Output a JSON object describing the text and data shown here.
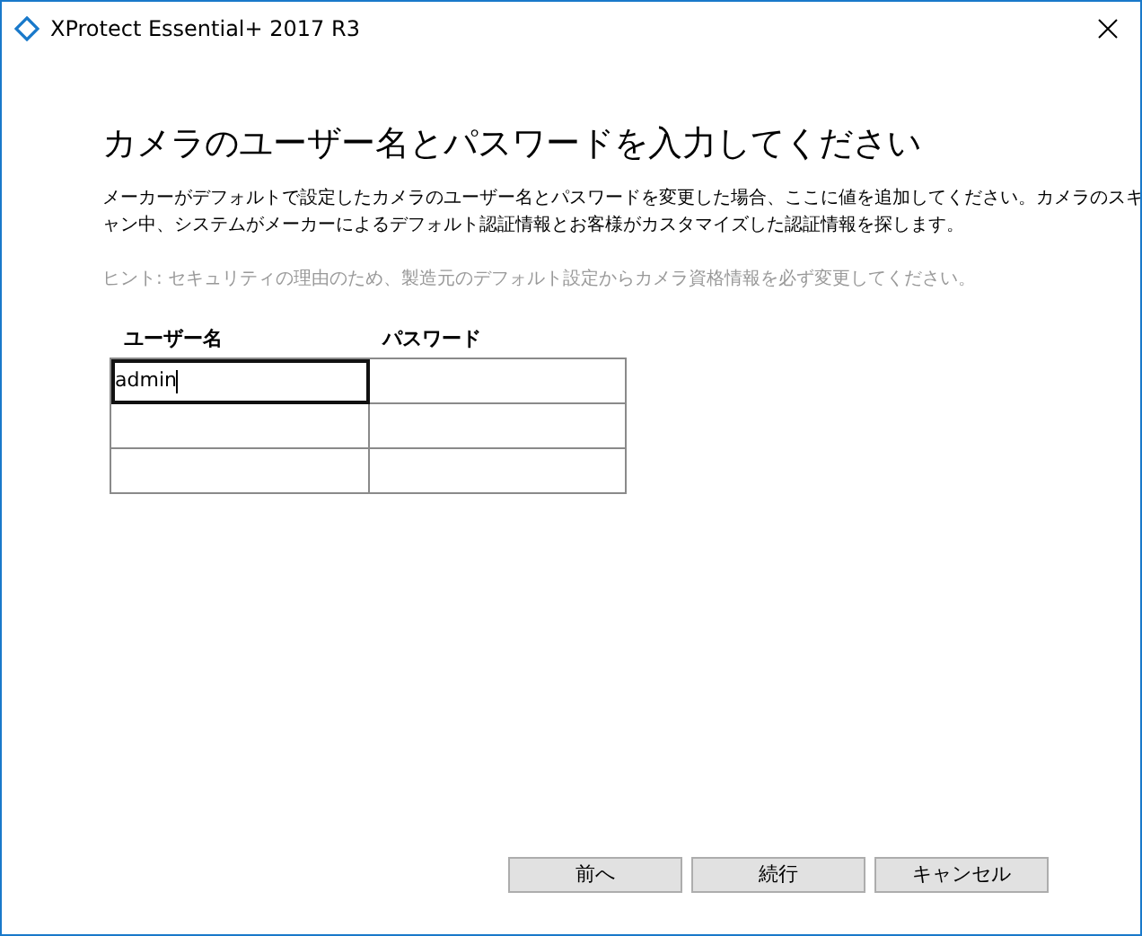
{
  "window": {
    "title": "XProtect Essential+ 2017 R3"
  },
  "heading": "カメラのユーザー名とパスワードを入力してください",
  "description": "メーカーがデフォルトで設定したカメラのユーザー名とパスワードを変更した場合、ここに値を追加してください。カメラのスキャン中、システムがメーカーによるデフォルト認証情報とお客様がカスタマイズした認証情報を探します。",
  "hint": "ヒント: セキュリティの理由のため、製造元のデフォルト設定からカメラ資格情報を必ず変更してください。",
  "table": {
    "columns": [
      "ユーザー名",
      "パスワード"
    ],
    "rows": [
      [
        {
          "value": "admin",
          "focused": true
        },
        {
          "focused": false
        }
      ],
      [
        {
          "focused": false
        },
        {
          "focused": false
        }
      ],
      [
        {
          "focused": false
        },
        {
          "focused": false
        }
      ]
    ]
  },
  "buttons": [
    "前へ",
    "続行",
    "キャンセル"
  ]
}
